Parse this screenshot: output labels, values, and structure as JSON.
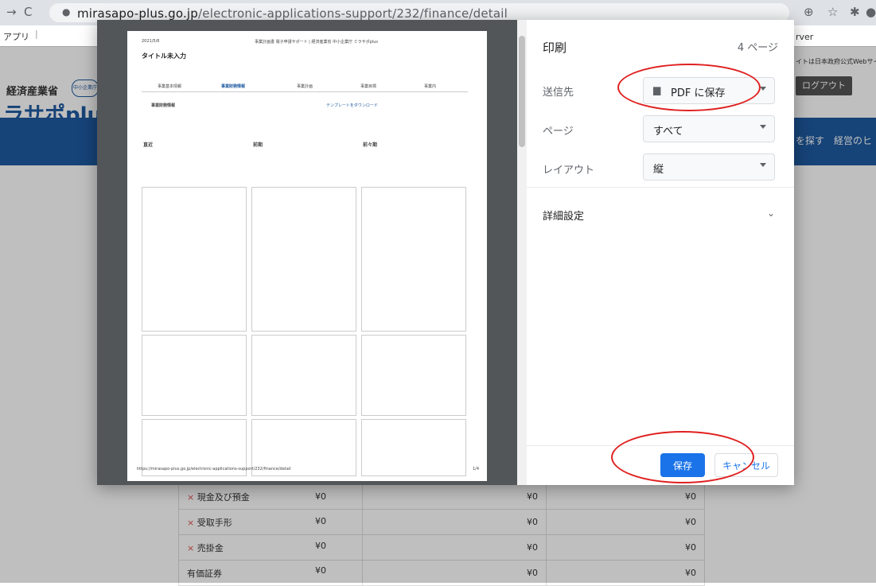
{
  "browser": {
    "url_host": "mirasapo-plus.go.jp",
    "url_path": "/electronic-applications-support/232/finance/detail",
    "bookmark_apps": "アプリ"
  },
  "background_page": {
    "ministry": "経済産業省",
    "agency_badge": "中小企業庁",
    "brand": "ラサポplu",
    "right_top": "rver",
    "right_note": "イトは日本政府公式Webサイトで",
    "login_button": "ログアウト",
    "nav_items": [
      "を探す",
      "経営のヒ"
    ],
    "rows": [
      {
        "label": "現金及び預金",
        "required": true,
        "v1": "¥0",
        "v2": "¥0",
        "v3": "¥0"
      },
      {
        "label": "受取手形",
        "required": true,
        "v1": "¥0",
        "v2": "¥0",
        "v3": "¥0"
      },
      {
        "label": "売掛金",
        "required": true,
        "v1": "¥0",
        "v2": "¥0",
        "v3": "¥0"
      },
      {
        "label": "有価証券",
        "required": false,
        "v1": "¥0",
        "v2": "¥0",
        "v3": "¥0"
      }
    ]
  },
  "print_dialog": {
    "title": "印刷",
    "page_count": "4 ページ",
    "destination_label": "送信先",
    "destination_value": "PDF に保存",
    "pages_label": "ページ",
    "pages_value": "すべて",
    "layout_label": "レイアウト",
    "layout_value": "縦",
    "more_settings": "詳細設定",
    "save_button": "保存",
    "cancel_button": "キャンセル"
  },
  "preview": {
    "date": "2021/5/6",
    "header_center": "事業計画書 電子申請サポート | 経済産業省 中小企業庁 ミラサポplus",
    "page_title": "タイトル未入力",
    "tabs": [
      "事業基本情報",
      "事業財務情報",
      "事業計画",
      "事業目標",
      "事業内"
    ],
    "section": "事業財務情報",
    "template_link": "テンプレートをダウンロード",
    "columns": [
      "直近",
      "前期",
      "前々期"
    ],
    "footer_url": "https://mirasapo-plus.go.jp/electronic-applications-support/232/finance/detail",
    "footer_page": "1/4"
  },
  "colors": {
    "accent": "#1a73e8",
    "annotation": "#e02020",
    "nav_blue": "#1e5aa0"
  }
}
